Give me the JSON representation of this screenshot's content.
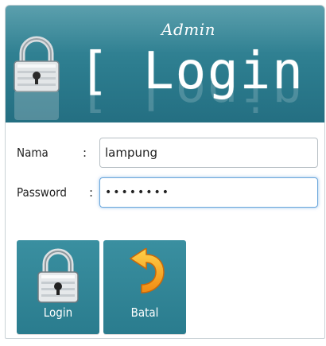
{
  "header": {
    "subtitle": "Admin",
    "title": "[ Login ]"
  },
  "form": {
    "nama_label": "Nama",
    "nama_colon": ":",
    "nama_value": "lampung",
    "password_label": "Password",
    "password_colon": ":",
    "password_value": "••••••••"
  },
  "buttons": {
    "login_label": "Login",
    "batal_label": "Batal"
  },
  "icons": {
    "header": "padlock-icon",
    "login": "padlock-icon",
    "batal": "undo-arrow-icon"
  },
  "colors": {
    "header_bg": "#2c7c8e",
    "button_bg": "#2f8294",
    "focus_border": "#69a6db"
  }
}
